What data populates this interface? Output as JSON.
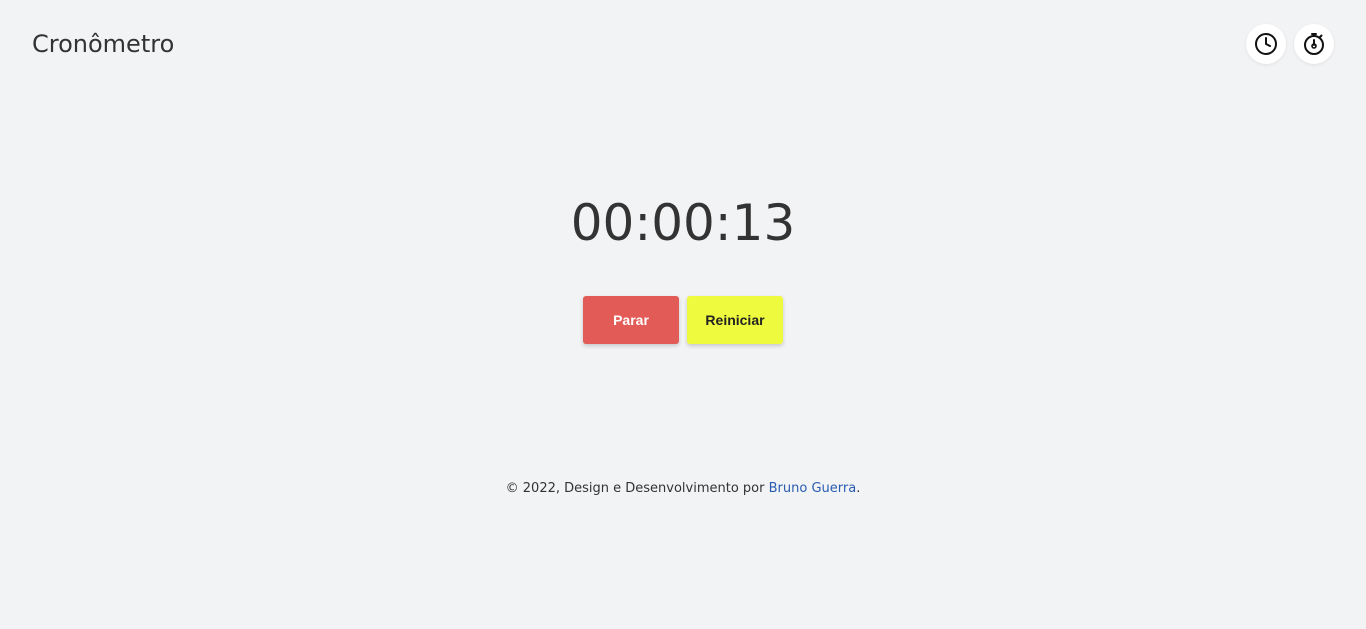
{
  "header": {
    "title": "Cronômetro",
    "icons": [
      "clock-icon",
      "stopwatch-icon"
    ]
  },
  "timer": {
    "display": "00:00:13"
  },
  "controls": {
    "stop_label": "Parar",
    "reset_label": "Reiniciar",
    "colors": {
      "stop": "#e25b57",
      "reset": "#eefa3d"
    }
  },
  "footer": {
    "prefix": "© 2022, Design e Desenvolvimento por ",
    "author_link": "Bruno Guerra",
    "suffix": ".",
    "link_color": "#2a5db0"
  }
}
